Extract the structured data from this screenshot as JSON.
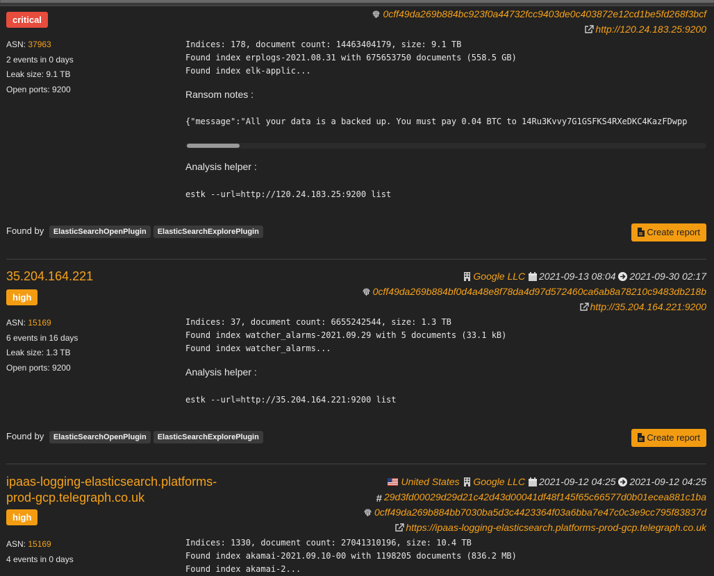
{
  "entries": [
    {
      "severity": "critical",
      "fingerprint": "0cff49da269b884bc923f0a44732fcc9403de0c403872e12cd1be5fd268f3bcf",
      "url": "http://120.24.183.25:9200",
      "asn_label": "ASN:",
      "asn": "37963",
      "events": "2 events in 0 days",
      "leak_size": "Leak size: 9.1 TB",
      "open_ports": "Open ports: 9200",
      "summary_lines": [
        "Indices: 178, document count: 14463404179, size: 9.1 TB",
        "Found index erplogs-2021.08.31 with 675653750 documents (558.5 GB)",
        "Found index elk-applic..."
      ],
      "ransom_label": "Ransom notes :",
      "ransom_text": "{\"message\":\"All your data is a backed up. You must pay 0.04 BTC to 14Ru3Kvvy7G1GSFKS4RXeDKC4KazFDwpp",
      "helper_label": "Analysis helper :",
      "helper_cmd": "estk --url=http://120.24.183.25:9200 list",
      "found_by_label": "Found by",
      "plugins": [
        "ElasticSearchOpenPlugin",
        "ElasticSearchExplorePlugin"
      ],
      "report_label": "Create report"
    },
    {
      "title": "35.204.164.221",
      "severity": "high",
      "org": "Google LLC",
      "first_seen": "2021-09-13 08:04",
      "last_seen": "2021-09-30 02:17",
      "fingerprint": "0cff49da269b884bf0d4a48e8f78da4d97d572460ca6ab8a78210c9483db218b",
      "url": "http://35.204.164.221:9200",
      "asn_label": "ASN:",
      "asn": "15169",
      "events": "6 events in 16 days",
      "leak_size": "Leak size: 1.3 TB",
      "open_ports": "Open ports: 9200",
      "summary_lines": [
        "Indices: 37, document count: 6655242544, size: 1.3 TB",
        "Found index watcher_alarms-2021.09.29 with 5 documents (33.1 kB)",
        "Found index watcher_alarms..."
      ],
      "helper_label": "Analysis helper :",
      "helper_cmd": "estk --url=http://35.204.164.221:9200 list",
      "found_by_label": "Found by",
      "plugins": [
        "ElasticSearchOpenPlugin",
        "ElasticSearchExplorePlugin"
      ],
      "report_label": "Create report"
    },
    {
      "title_line1": "ipaas-logging-elasticsearch.platforms-",
      "title_line2": "prod-gcp.telegraph.co.uk",
      "severity": "high",
      "country": "United States",
      "org": "Google LLC",
      "first_seen": "2021-09-12 04:25",
      "last_seen": "2021-09-12 04:25",
      "hash": "29d3fd00029d29d21c42d43d00041df48f145f65c66577d0b01ecea881c1ba",
      "fingerprint": "0cff49da269b884bb7030ba5d3c4423364f03a6bba7e47c0c3e9cc795f83837d",
      "url": "https://ipaas-logging-elasticsearch.platforms-prod-gcp.telegraph.co.uk",
      "asn_label": "ASN:",
      "asn": "15169",
      "events": "4 events in 0 days",
      "summary_lines": [
        "Indices: 1330, document count: 27041310196, size: 10.4 TB",
        "Found index akamai-2021.09.10-00 with 1198205 documents (836.2 MB)",
        "Found index akamai-2..."
      ]
    }
  ],
  "colors": {
    "accent": "#f6a21b",
    "critical": "#e74c3c",
    "high": "#f39c12",
    "background": "#222222"
  },
  "icons": [
    "fingerprint-icon",
    "external-link-icon",
    "building-icon",
    "calendar-icon",
    "arrow-circle-right-icon",
    "hash-icon",
    "flag-us-icon",
    "file-pdf-icon"
  ]
}
